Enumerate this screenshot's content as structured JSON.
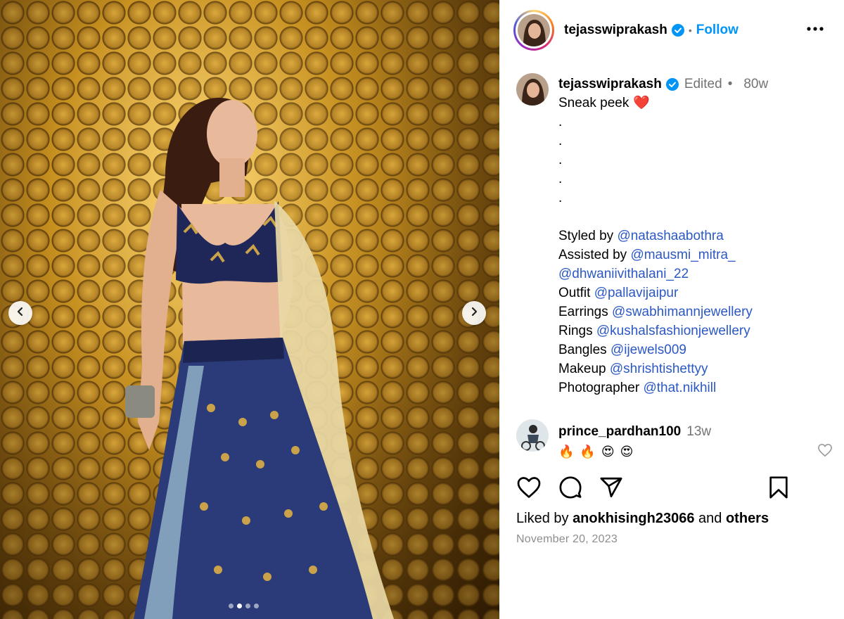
{
  "post": {
    "username": "tejasswiprakash",
    "separator": "•",
    "follow_label": "Follow",
    "more_icon": "more-options-icon",
    "colors": {
      "accent": "#0095f6",
      "mention": "#2b58c5",
      "muted": "#737373"
    },
    "media": {
      "carousel_count": 4,
      "active_index": 1
    },
    "caption": {
      "username": "tejasswiprakash",
      "edited_label": "Edited",
      "dot": "•",
      "age": "80w",
      "first_line": "Sneak peek",
      "heart": "❤️",
      "dots": [
        ".",
        ".",
        ".",
        ".",
        "."
      ],
      "credits": [
        {
          "label": "Styled by",
          "handle": "@natashaabothra"
        },
        {
          "label": "Assisted by",
          "handle": "@mausmi_mitra_"
        },
        {
          "label": "",
          "handle": "@dhwaniivithalani_22"
        },
        {
          "label": "Outfit",
          "handle": "@pallavijaipur"
        },
        {
          "label": "Earrings",
          "handle": "@swabhimannjewellery"
        },
        {
          "label": "Rings",
          "handle": "@kushalsfashionjewellery"
        },
        {
          "label": "Bangles",
          "handle": "@ijewels009"
        },
        {
          "label": "Makeup",
          "handle": "@shrishtishettyy"
        },
        {
          "label": "Photographer",
          "handle": "@that.nikhill"
        }
      ]
    },
    "comment": {
      "username": "prince_pardhan100",
      "age": "13w",
      "emojis": [
        "🔥",
        "🔥",
        "😍",
        "😍"
      ]
    },
    "likes": {
      "prefix": "Liked by",
      "user": "anokhisingh23066",
      "middle": "and",
      "others": "others"
    },
    "date": "November 20, 2023"
  }
}
